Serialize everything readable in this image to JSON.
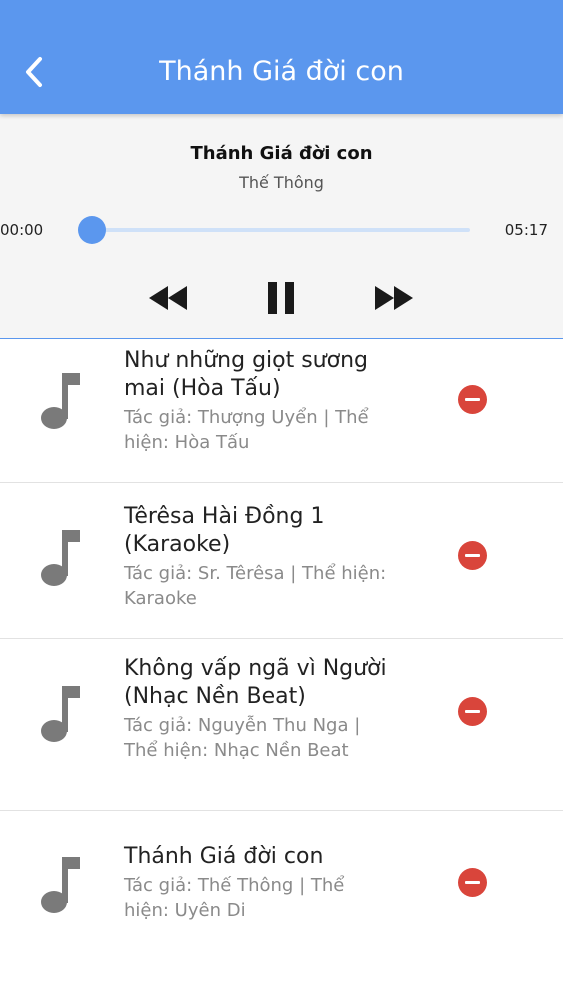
{
  "header": {
    "title": "Thánh Giá đời con",
    "back_icon": "chevron-left-icon"
  },
  "player": {
    "song_title": "Thánh Giá đời con",
    "song_artist": "Thế Thông",
    "time_elapsed": "00:00",
    "time_total": "05:17",
    "progress": 0.0,
    "controls": [
      "rewind-icon",
      "pause-icon",
      "fast-forward-icon"
    ],
    "accent_color": "#5b97ee"
  },
  "playlist": [
    {
      "title": "Như những giọt sương mai (Hòa Tấu)",
      "subtitle": "Tác giả: Thượng Uyển | Thể hiện: Hòa Tấu"
    },
    {
      "title": "Têrêsa Hài Đồng 1 (Karaoke)",
      "subtitle": "Tác giả: Sr. Têrêsa | Thể hiện: Karaoke"
    },
    {
      "title": "Không vấp ngã vì Người (Nhạc Nền Beat)",
      "subtitle": "Tác giả: Nguyễn Thu Nga | Thể hiện: Nhạc Nền Beat"
    },
    {
      "title": "Thánh Giá đời con",
      "subtitle": "Tác giả: Thế Thông | Thể hiện: Uyên Di"
    }
  ],
  "colors": {
    "app_bar": "#5b97ee",
    "remove": "#d9453b",
    "note_icon": "#7a7a7a"
  }
}
